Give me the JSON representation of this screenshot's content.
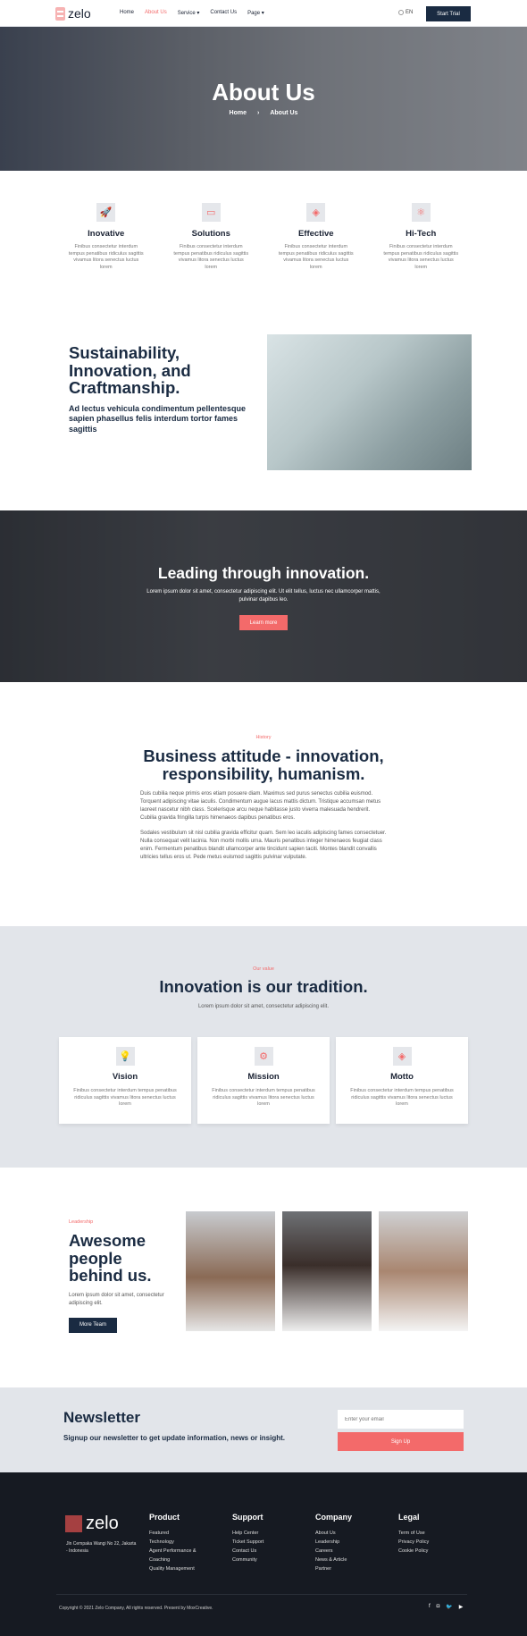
{
  "nav": {
    "logo": "zelo",
    "items": [
      "Home",
      "About Us",
      "Service",
      "Contact Us",
      "Page"
    ],
    "active": "About Us",
    "lang": "EN",
    "cta": "Start Trial"
  },
  "hero": {
    "title": "About Us",
    "crumb": [
      "Home",
      "About Us"
    ]
  },
  "features": [
    {
      "icon": "rocket-icon",
      "title": "Inovative",
      "text": "Finibus consectetur interdum tempus penatibus ridiculus sagittis vivamus litora senectus luctus lorem"
    },
    {
      "icon": "briefcase-icon",
      "title": "Solutions",
      "text": "Finibus consectetur interdum tempus penatibus ridiculus sagittis vivamus litora senectus luctus lorem"
    },
    {
      "icon": "layers-icon",
      "title": "Effective",
      "text": "Finibus consectetur interdum tempus penatibus ridiculus sagittis vivamus litora senectus luctus lorem"
    },
    {
      "icon": "atom-icon",
      "title": "Hi-Tech",
      "text": "Finibus consectetur interdum tempus penatibus ridiculus sagittis vivamus litora senectus luctus lorem"
    }
  ],
  "sustain": {
    "title": "Sustainability, Innovation, and Craftmanship.",
    "text": "Ad lectus vehicula condimentum pellentesque sapien phasellus felis interdum tortor fames sagittis"
  },
  "band": {
    "title": "Leading through innovation.",
    "text": "Lorem ipsum dolor sit amet, consectetur adipiscing elit. Ut elit tellus, luctus nec ullamcorper mattis, pulvinar dapibus leo.",
    "button": "Learn more"
  },
  "history": {
    "tag": "History",
    "title": "Business attitude - innovation, responsibility, humanism.",
    "p1": "Duis cubilia neque primis eros etiam posuere diam. Maximus sed purus senectus cubilia euismod. Torquent adipiscing vitae iaculis. Condimentum augue lacus mattis dictum. Tristique accumsan metus laoreet nascetur nibh class. Scelerisque arcu neque habitasse justo viverra malesuada hendrerit. Cubilia gravida fringilla turpis himenaeos dapibus penatibus eros.",
    "p2": "Sodales vestibulum sit nisl cubilia gravida efficitur quam. Sem leo iaculis adipiscing fames consectetuer. Nulla consequat velit lacinia. Non morbi mollis urna. Mauris penatibus integer himenaeos feugiat class enim. Fermentum penatibus blandit ullamcorper ante tincidunt sapien taciti. Montes blandit convallis ultricies tellus eros ut. Pede metus euismod sagittis pulvinar vulputate."
  },
  "values": {
    "tag": "Our value",
    "title": "Innovation is our tradition.",
    "sub": "Lorem ipsum dolor sit amet, consectetur adipiscing elit.",
    "cards": [
      {
        "icon": "lightbulb-icon",
        "title": "Vision",
        "text": "Finibus consectetur interdum tempus penatibus ridiculus sagittis vivamus litora senectus luctus lorem"
      },
      {
        "icon": "gear-icon",
        "title": "Mission",
        "text": "Finibus consectetur interdum tempus penatibus ridiculus sagittis vivamus litora senectus luctus lorem"
      },
      {
        "icon": "layers-icon",
        "title": "Motto",
        "text": "Finibus consectetur interdum tempus penatibus ridiculus sagittis vivamus litora senectus luctus lorem"
      }
    ]
  },
  "leadership": {
    "tag": "Leadership",
    "title": "Awesome people behind us.",
    "text": "Lorem ipsum dolor sit amet, consectetur adipiscing elit.",
    "button": "More Team"
  },
  "newsletter": {
    "title": "Newsletter",
    "text": "Signup our newsletter to get update information, news or insight.",
    "placeholder": "Enter your email",
    "button": "Sign Up"
  },
  "footer": {
    "logo": "zelo",
    "address": "Jln Cempaka Wangi No 22, Jakarta - Indonesia",
    "cols": [
      {
        "title": "Product",
        "items": [
          "Featured",
          "Technology",
          "Agent Performance & Coaching",
          "Quality Management"
        ]
      },
      {
        "title": "Support",
        "items": [
          "Help Center",
          "Ticket Support",
          "Contact Us",
          "Community"
        ]
      },
      {
        "title": "Company",
        "items": [
          "About Us",
          "Leadership",
          "Careers",
          "News & Article",
          "Partner"
        ]
      },
      {
        "title": "Legal",
        "items": [
          "Term of Use",
          "Privacy Policy",
          "Cookie Policy"
        ]
      }
    ],
    "copyright": "Copyright © 2021 Zelo Company, All rights reserved. Present by MoxCreative.",
    "social": [
      "facebook-icon",
      "instagram-icon",
      "twitter-icon",
      "youtube-icon"
    ]
  }
}
